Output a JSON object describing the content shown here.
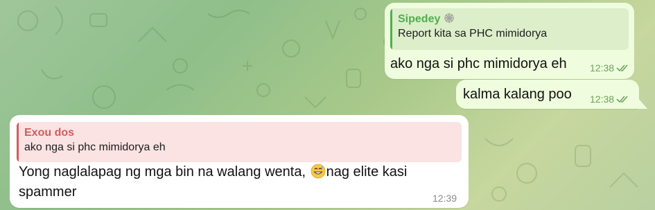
{
  "colors": {
    "outgoing_bubble": "#effdde",
    "incoming_bubble": "#ffffff",
    "reply_green": "#4fae4e",
    "reply_red": "#d25c5c",
    "checkmarks": "#6aa25a"
  },
  "messages": [
    {
      "direction": "outgoing",
      "reply": {
        "name": "Sipedey",
        "name_emoji_icon": "spider-web-icon",
        "text": "Report kita sa PHC mimidorya"
      },
      "text": "ako nga si phc mimidorya eh",
      "time": "12:38",
      "status_icon": "double-check-icon"
    },
    {
      "direction": "outgoing",
      "text": "kalma kalang poo",
      "time": "12:38",
      "status_icon": "double-check-icon"
    },
    {
      "direction": "incoming",
      "reply": {
        "name": "Exou dos",
        "text": "ako nga si phc mimidorya eh"
      },
      "text_before_emoji": "Yong naglalapag ng mga bin na walang wenta,",
      "emoji_icon": "grinning-sweat-emoji-icon",
      "text_after_emoji": "nag elite kasi",
      "text_line2": "spammer",
      "time": "12:39"
    }
  ]
}
